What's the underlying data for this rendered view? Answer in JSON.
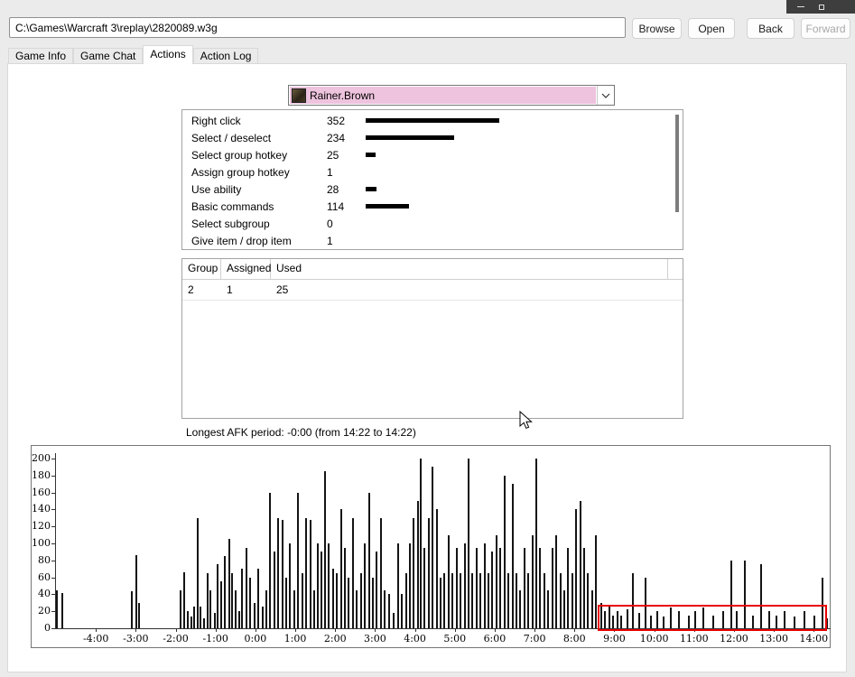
{
  "window": {
    "icons": {
      "minimize": "minimize-icon",
      "maximize": "maximize-icon"
    }
  },
  "toolbar": {
    "path_value": "C:\\Games\\Warcraft 3\\replay\\2820089.w3g",
    "browse_label": "Browse",
    "open_label": "Open",
    "back_label": "Back",
    "forward_label": "Forward"
  },
  "tabs": [
    {
      "label": "Game Info",
      "active": false
    },
    {
      "label": "Game Chat",
      "active": false
    },
    {
      "label": "Actions",
      "active": true
    },
    {
      "label": "Action Log",
      "active": false
    }
  ],
  "player_dropdown": {
    "value": "Rainer.Brown",
    "highlight_color": "#eec3dd"
  },
  "action_stats": {
    "bar_color": "#000000",
    "rows": [
      {
        "label": "Right click",
        "count": 352
      },
      {
        "label": "Select / deselect",
        "count": 234
      },
      {
        "label": "Select group hotkey",
        "count": 25
      },
      {
        "label": "Assign group hotkey",
        "count": 1
      },
      {
        "label": "Use ability",
        "count": 28
      },
      {
        "label": "Basic commands",
        "count": 114
      },
      {
        "label": "Select subgroup",
        "count": 0
      },
      {
        "label": "Give item / drop item",
        "count": 1
      }
    ]
  },
  "hotkey_table": {
    "columns": [
      "Group",
      "Assigned",
      "Used"
    ],
    "rows": [
      [
        "2",
        "1",
        "25"
      ]
    ]
  },
  "afk_text": "Longest AFK period: -0:00 (from 14:22 to 14:22)",
  "chart_data": {
    "type": "bar",
    "title": "",
    "xlabel": "",
    "ylabel": "",
    "ylim": [
      0,
      200
    ],
    "yticks": [
      0,
      20,
      40,
      60,
      80,
      100,
      120,
      140,
      160,
      180,
      200
    ],
    "xtick_labels": [
      "-4:00",
      "-3:00",
      "-2:00",
      "-1:00",
      "0:00",
      "1:00",
      "2:00",
      "3:00",
      "4:00",
      "5:00",
      "6:00",
      "7:00",
      "8:00",
      "9:00",
      "10:00",
      "11:00",
      "12:00",
      "13:00",
      "14:00"
    ],
    "xtick_minutes": [
      -4,
      -3,
      -2,
      -1,
      0,
      1,
      2,
      3,
      4,
      5,
      6,
      7,
      8,
      9,
      10,
      11,
      12,
      13,
      14
    ],
    "xlim_minutes": [
      -5.0,
      14.4
    ],
    "grid": false,
    "bar_color": "#141414",
    "bars": [
      [
        -5.0,
        45
      ],
      [
        -4.87,
        42
      ],
      [
        -3.12,
        44
      ],
      [
        -3.0,
        86
      ],
      [
        -2.93,
        30
      ],
      [
        -1.9,
        45
      ],
      [
        -1.8,
        66
      ],
      [
        -1.72,
        20
      ],
      [
        -1.63,
        14
      ],
      [
        -1.55,
        25
      ],
      [
        -1.48,
        130
      ],
      [
        -1.4,
        25
      ],
      [
        -1.32,
        12
      ],
      [
        -1.23,
        65
      ],
      [
        -1.15,
        45
      ],
      [
        -1.05,
        18
      ],
      [
        -0.97,
        75
      ],
      [
        -0.88,
        55
      ],
      [
        -0.78,
        85
      ],
      [
        -0.68,
        105
      ],
      [
        -0.6,
        65
      ],
      [
        -0.52,
        45
      ],
      [
        -0.43,
        20
      ],
      [
        -0.35,
        70
      ],
      [
        -0.25,
        95
      ],
      [
        -0.15,
        60
      ],
      [
        -0.05,
        30
      ],
      [
        0.05,
        70
      ],
      [
        0.15,
        25
      ],
      [
        0.25,
        45
      ],
      [
        0.35,
        160
      ],
      [
        0.45,
        90
      ],
      [
        0.55,
        130
      ],
      [
        0.65,
        128
      ],
      [
        0.75,
        60
      ],
      [
        0.85,
        100
      ],
      [
        0.95,
        45
      ],
      [
        1.05,
        160
      ],
      [
        1.15,
        65
      ],
      [
        1.25,
        130
      ],
      [
        1.35,
        128
      ],
      [
        1.45,
        45
      ],
      [
        1.55,
        100
      ],
      [
        1.63,
        90
      ],
      [
        1.72,
        185
      ],
      [
        1.82,
        100
      ],
      [
        1.92,
        70
      ],
      [
        2.02,
        65
      ],
      [
        2.12,
        140
      ],
      [
        2.22,
        95
      ],
      [
        2.32,
        60
      ],
      [
        2.42,
        130
      ],
      [
        2.52,
        45
      ],
      [
        2.62,
        65
      ],
      [
        2.72,
        100
      ],
      [
        2.82,
        160
      ],
      [
        2.92,
        60
      ],
      [
        3.02,
        90
      ],
      [
        3.12,
        130
      ],
      [
        3.22,
        45
      ],
      [
        3.32,
        40
      ],
      [
        3.45,
        18
      ],
      [
        3.55,
        100
      ],
      [
        3.65,
        40
      ],
      [
        3.75,
        65
      ],
      [
        3.85,
        100
      ],
      [
        3.95,
        130
      ],
      [
        4.05,
        150
      ],
      [
        4.13,
        200
      ],
      [
        4.22,
        95
      ],
      [
        4.32,
        130
      ],
      [
        4.42,
        190
      ],
      [
        4.52,
        140
      ],
      [
        4.62,
        60
      ],
      [
        4.72,
        65
      ],
      [
        4.82,
        110
      ],
      [
        4.92,
        65
      ],
      [
        5.02,
        95
      ],
      [
        5.12,
        65
      ],
      [
        5.22,
        100
      ],
      [
        5.32,
        200
      ],
      [
        5.42,
        65
      ],
      [
        5.52,
        95
      ],
      [
        5.62,
        65
      ],
      [
        5.72,
        100
      ],
      [
        5.82,
        65
      ],
      [
        5.92,
        90
      ],
      [
        6.02,
        110
      ],
      [
        6.12,
        95
      ],
      [
        6.22,
        180
      ],
      [
        6.32,
        65
      ],
      [
        6.42,
        170
      ],
      [
        6.52,
        65
      ],
      [
        6.62,
        45
      ],
      [
        6.72,
        95
      ],
      [
        6.82,
        65
      ],
      [
        6.92,
        110
      ],
      [
        7.02,
        200
      ],
      [
        7.12,
        95
      ],
      [
        7.22,
        65
      ],
      [
        7.32,
        45
      ],
      [
        7.42,
        95
      ],
      [
        7.52,
        110
      ],
      [
        7.62,
        65
      ],
      [
        7.72,
        45
      ],
      [
        7.82,
        95
      ],
      [
        7.92,
        65
      ],
      [
        8.02,
        140
      ],
      [
        8.12,
        150
      ],
      [
        8.22,
        95
      ],
      [
        8.32,
        65
      ],
      [
        8.42,
        45
      ],
      [
        8.52,
        110
      ],
      [
        8.65,
        30
      ],
      [
        8.75,
        20
      ],
      [
        8.85,
        25
      ],
      [
        8.95,
        15
      ],
      [
        9.05,
        20
      ],
      [
        9.15,
        15
      ],
      [
        9.3,
        22
      ],
      [
        9.45,
        65
      ],
      [
        9.6,
        18
      ],
      [
        9.75,
        60
      ],
      [
        9.9,
        15
      ],
      [
        10.05,
        20
      ],
      [
        10.2,
        14
      ],
      [
        10.4,
        24
      ],
      [
        10.6,
        20
      ],
      [
        10.85,
        15
      ],
      [
        11.0,
        20
      ],
      [
        11.2,
        24
      ],
      [
        11.45,
        15
      ],
      [
        11.7,
        20
      ],
      [
        11.9,
        80
      ],
      [
        12.05,
        20
      ],
      [
        12.25,
        80
      ],
      [
        12.45,
        15
      ],
      [
        12.65,
        75
      ],
      [
        12.85,
        20
      ],
      [
        13.05,
        15
      ],
      [
        13.25,
        20
      ],
      [
        13.5,
        14
      ],
      [
        13.75,
        20
      ],
      [
        14.0,
        15
      ],
      [
        14.2,
        60
      ],
      [
        14.3,
        12
      ]
    ],
    "afk_highlight": {
      "start_min": 8.58,
      "end_min": 14.33,
      "value_top": 28,
      "color": "#e80000"
    }
  }
}
